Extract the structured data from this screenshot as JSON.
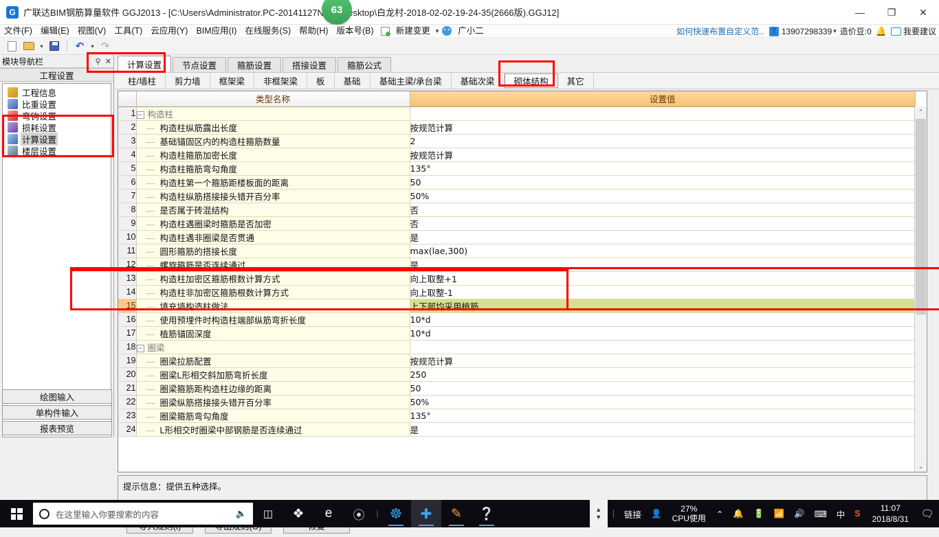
{
  "window": {
    "title": "广联达BIM钢筋算量软件 GGJ2013 - [C:\\Users\\Administrator.PC-20141127NRHI\\Desktop\\白龙村-2018-02-02-19-24-35(2666版).GGJ12]",
    "logo": "app-logo",
    "badge": "63",
    "minimize": "—",
    "maximize": "❐",
    "close": "✕"
  },
  "menu": {
    "items": [
      "文件(F)",
      "编辑(E)",
      "视图(V)",
      "工具(T)",
      "云应用(Y)",
      "BIM应用(I)",
      "在线服务(S)",
      "帮助(H)",
      "版本号(B)"
    ],
    "new_change": "新建变更",
    "caret": "▾",
    "assistant": "广小二",
    "help_link": "如何快速布置自定义范..",
    "account": "13907298339",
    "account_caret": "▾",
    "points": "造价豆:0",
    "bell": "🔔",
    "suggest": "我要建议"
  },
  "toolbar": {
    "new_tooltip": "新建",
    "open_tooltip": "打开",
    "save_tooltip": "保存",
    "undo_tooltip": "撤销",
    "redo_tooltip": "恢复",
    "caret": "▾"
  },
  "nav": {
    "header_title": "模块导航栏",
    "pin": "⚲",
    "close": "✕",
    "section_title": "工程设置",
    "items": [
      {
        "label": "工程信息",
        "icon": "project-info-icon",
        "selected": false
      },
      {
        "label": "比重设置",
        "icon": "weight-setting-icon",
        "selected": false
      },
      {
        "label": "弯钩设置",
        "icon": "hook-setting-icon",
        "selected": false
      },
      {
        "label": "损耗设置",
        "icon": "loss-setting-icon",
        "selected": false
      },
      {
        "label": "计算设置",
        "icon": "calc-setting-icon",
        "selected": true
      },
      {
        "label": "楼层设置",
        "icon": "floor-setting-icon",
        "selected": false
      }
    ],
    "footer": [
      "绘图输入",
      "单构件输入",
      "报表预览"
    ]
  },
  "tabs_primary": [
    {
      "label": "计算设置",
      "active": true
    },
    {
      "label": "节点设置",
      "active": false
    },
    {
      "label": "箍筋设置",
      "active": false
    },
    {
      "label": "搭接设置",
      "active": false
    },
    {
      "label": "箍筋公式",
      "active": false
    }
  ],
  "tabs_secondary": [
    {
      "label": "柱/墙柱",
      "active": false
    },
    {
      "label": "剪力墙",
      "active": false
    },
    {
      "label": "框架梁",
      "active": false
    },
    {
      "label": "非框架梁",
      "active": false
    },
    {
      "label": "板",
      "active": false
    },
    {
      "label": "基础",
      "active": false
    },
    {
      "label": "基础主梁/承台梁",
      "active": false
    },
    {
      "label": "基础次梁",
      "active": false
    },
    {
      "label": "砌体结构",
      "active": true
    },
    {
      "label": "其它",
      "active": false
    }
  ],
  "grid": {
    "headers": {
      "num": "",
      "name": "类型名称",
      "value": "设置值"
    },
    "rows": [
      {
        "num": "1",
        "name": "构造柱",
        "value": "",
        "type": "group"
      },
      {
        "num": "2",
        "name": "构造柱纵筋露出长度",
        "value": "按规范计算",
        "type": "child"
      },
      {
        "num": "3",
        "name": "基础锚固区内的构造柱箍筋数量",
        "value": "2",
        "type": "child"
      },
      {
        "num": "4",
        "name": "构造柱箍筋加密长度",
        "value": "按规范计算",
        "type": "child"
      },
      {
        "num": "5",
        "name": "构造柱箍筋弯勾角度",
        "value": "135°",
        "type": "child"
      },
      {
        "num": "6",
        "name": "构造柱第一个箍筋距楼板面的距离",
        "value": "50",
        "type": "child"
      },
      {
        "num": "7",
        "name": "构造柱纵筋搭接接头错开百分率",
        "value": "50%",
        "type": "child"
      },
      {
        "num": "8",
        "name": "是否属于砖混结构",
        "value": "否",
        "type": "child"
      },
      {
        "num": "9",
        "name": "构造柱遇圈梁时箍筋是否加密",
        "value": "否",
        "type": "child"
      },
      {
        "num": "10",
        "name": "构造柱遇非圈梁是否贯通",
        "value": "是",
        "type": "child"
      },
      {
        "num": "11",
        "name": "圆形箍筋的搭接长度",
        "value": "max(lae,300)",
        "type": "child"
      },
      {
        "num": "12",
        "name": "螺旋箍筋是否连续通过",
        "value": "是",
        "type": "child"
      },
      {
        "num": "13",
        "name": "构造柱加密区箍筋根数计算方式",
        "value": "向上取整+1",
        "type": "child"
      },
      {
        "num": "14",
        "name": "构造柱非加密区箍筋根数计算方式",
        "value": "向上取整-1",
        "type": "child"
      },
      {
        "num": "15",
        "name": "填充墙构造柱做法",
        "value": "上下部均采用植筋",
        "type": "child",
        "selected": true
      },
      {
        "num": "16",
        "name": "使用预埋件时构造柱端部纵筋弯折长度",
        "value": "10*d",
        "type": "child"
      },
      {
        "num": "17",
        "name": "植筋锚固深度",
        "value": "10*d",
        "type": "child"
      },
      {
        "num": "18",
        "name": "圈梁",
        "value": "",
        "type": "group"
      },
      {
        "num": "19",
        "name": "圈梁拉筋配置",
        "value": "按规范计算",
        "type": "child"
      },
      {
        "num": "20",
        "name": "圈梁L形相交斜加筋弯折长度",
        "value": "250",
        "type": "child"
      },
      {
        "num": "21",
        "name": "圈梁箍筋距构造柱边缘的距离",
        "value": "50",
        "type": "child"
      },
      {
        "num": "22",
        "name": "圈梁纵筋搭接接头错开百分率",
        "value": "50%",
        "type": "child"
      },
      {
        "num": "23",
        "name": "圈梁箍筋弯勾角度",
        "value": "135°",
        "type": "child"
      },
      {
        "num": "24",
        "name": "L形相交时圈梁中部钢筋是否连续通过",
        "value": "是",
        "type": "child"
      }
    ],
    "scroll_up": "⌃",
    "scroll_down": "⌄"
  },
  "hint": {
    "text": "提示信息：提供五种选择。"
  },
  "buttons": [
    {
      "label": "导入规则(I)",
      "name": "import-rules-button"
    },
    {
      "label": "导出规则(O)",
      "name": "export-rules-button"
    },
    {
      "label": "恢复",
      "name": "restore-button"
    }
  ],
  "taskbar": {
    "search_placeholder": "在这里输入你要搜索的内容",
    "mic": "🎤",
    "links_label": "链接",
    "cpu_pct": "27%",
    "cpu_label": "CPU使用",
    "time": "11:07",
    "date": "2018/8/31",
    "ime": "中",
    "chevron": "⌃",
    "bell": "🔔",
    "tray_icons": [
      "chevron-up-icon",
      "bell-icon",
      "battery-icon",
      "wifi-icon",
      "volume-icon",
      "keyboard-icon",
      "ime-icon",
      "sogou-icon"
    ],
    "apps": [
      "task-view-icon",
      "ps-icon",
      "edge-icon",
      "cortana-icon",
      "glodon-icon",
      "gld-app-icon",
      "notes-icon",
      "help-icon"
    ]
  },
  "colors": {
    "accent_orange": "#f6c172",
    "highlight_green": "#d7e08f",
    "row_yellow": "#fefde8",
    "annotation_red": "#ff0000",
    "link_blue": "#1f6fb5"
  }
}
